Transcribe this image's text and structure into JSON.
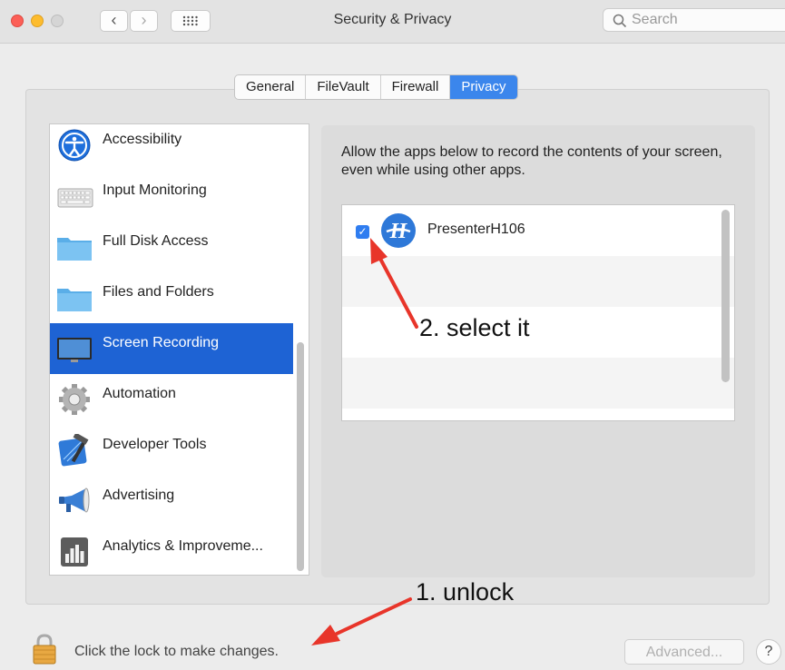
{
  "window": {
    "title": "Security & Privacy"
  },
  "search": {
    "placeholder": "Search"
  },
  "tabs": [
    {
      "label": "General"
    },
    {
      "label": "FileVault"
    },
    {
      "label": "Firewall"
    },
    {
      "label": "Privacy",
      "active": true
    }
  ],
  "sidebar": {
    "items": [
      {
        "label": "Accessibility",
        "icon": "accessibility-icon"
      },
      {
        "label": "Input Monitoring",
        "icon": "keyboard-icon"
      },
      {
        "label": "Full Disk Access",
        "icon": "folder-icon"
      },
      {
        "label": "Files and Folders",
        "icon": "folder-icon"
      },
      {
        "label": "Screen Recording",
        "icon": "display-icon",
        "selected": true
      },
      {
        "label": "Automation",
        "icon": "gear-icon"
      },
      {
        "label": "Developer Tools",
        "icon": "hammer-icon"
      },
      {
        "label": "Advertising",
        "icon": "megaphone-icon"
      },
      {
        "label": "Analytics & Improveme...",
        "icon": "bar-chart-icon"
      }
    ]
  },
  "main": {
    "description": "Allow the apps below to record the contents of your screen, even while using other apps.",
    "apps": [
      {
        "name": "PresenterH106",
        "checked": true,
        "icon": "presenter-app-icon"
      }
    ]
  },
  "annotations": {
    "step1": "1. unlock",
    "step2": "2. select it",
    "arrow_color": "#e8352a"
  },
  "footer": {
    "lock_text": "Click the lock to make changes.",
    "advanced_label": "Advanced...",
    "help_label": "?"
  },
  "colors": {
    "accent": "#3b86ec",
    "selection": "#1e63d4"
  }
}
